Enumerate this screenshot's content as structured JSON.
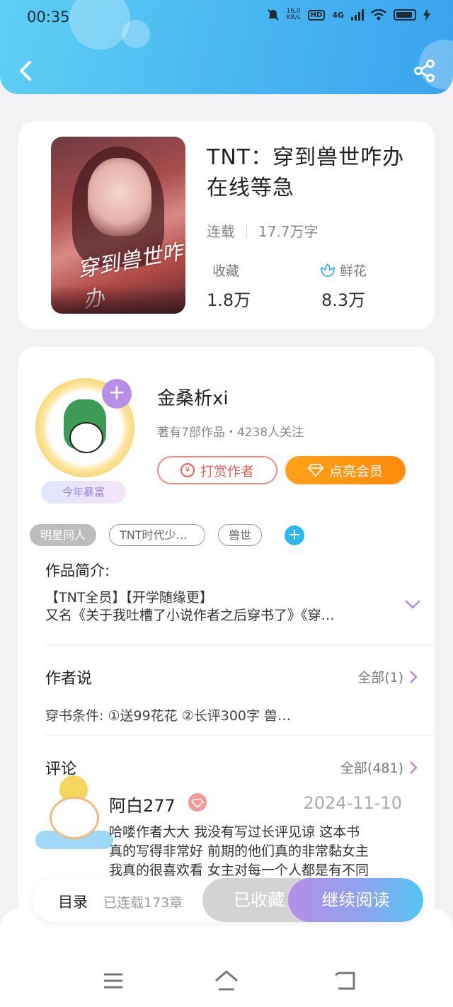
{
  "status_bar": {
    "time": "00:35",
    "net_speed": "16.0",
    "net_unit": "KB/s",
    "hd": "HD",
    "signal": "4G"
  },
  "book": {
    "title": "TNT：穿到兽世咋办在线等急",
    "cover_text": "穿到兽世咋办",
    "status": "连载",
    "word_count": "17.7万字",
    "favorites_label": "收藏",
    "favorites_value": "1.8万",
    "flowers_label": "鲜花",
    "flowers_value": "8.3万"
  },
  "author": {
    "name": "金桑析xi",
    "info": "著有7部作品・4238人关注",
    "badge": "今年暴富",
    "tip_button": "打赏作者",
    "tip_icon_text": "¥",
    "vip_button": "点亮会员"
  },
  "tags": [
    "明星同人",
    "TNT时代少…",
    "兽世"
  ],
  "intro": {
    "title": "作品简介:",
    "line1": "【TNT全员】【开学随缘更】",
    "line2": "又名《关于我吐槽了小说作者之后穿书了》《穿…"
  },
  "author_says": {
    "title": "作者说",
    "more": "全部(1)",
    "text": "穿书条件: ①送99花花 ②长评300字   兽…"
  },
  "comments": {
    "title": "评论",
    "more": "全部(481)",
    "items": [
      {
        "user": "阿白277",
        "date": "2024-11-10",
        "line1": "哈喽作者大大 我没有写过长评见谅 这本书",
        "line2": "真的写得非常好 前期的他们真的非常黏女主",
        "line3": "我真的很喜欢看 女主对每一个人都是有不同"
      }
    ]
  },
  "bottom_bar": {
    "toc": "目录",
    "chapters": "已连载173章",
    "collected": "已收藏",
    "continue": "继续阅读"
  },
  "colors": {
    "header_start": "#5ed0f5",
    "header_end": "#3aa3ee",
    "vip_orange": "#ff9412",
    "tip_red": "#ea5e5a",
    "read_gradient_start": "#b58ee8",
    "read_gradient_end": "#53c6f4"
  },
  "icons": [
    "back-icon",
    "share-icon",
    "flower-icon",
    "coin-icon",
    "diamond-icon",
    "plus-icon",
    "chevron-down-icon",
    "chevron-right-icon",
    "menu-icon",
    "home-icon",
    "return-icon"
  ]
}
